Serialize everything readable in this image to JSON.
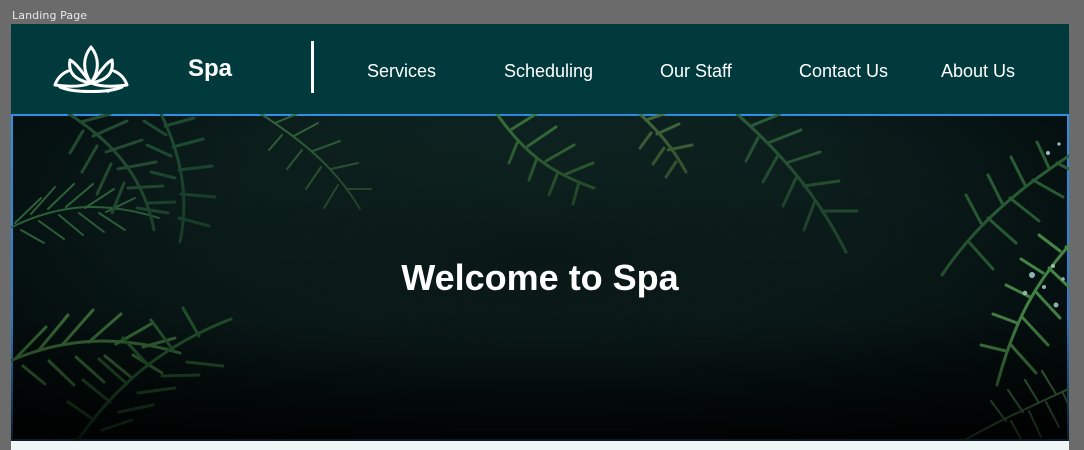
{
  "canvas": {
    "frame_label": "Landing Page"
  },
  "header": {
    "brand": "Spa",
    "logo_icon": "lotus-icon",
    "nav": [
      {
        "label": "Services"
      },
      {
        "label": "Scheduling"
      },
      {
        "label": "Our Staff"
      },
      {
        "label": "Contact Us"
      },
      {
        "label": "About Us"
      }
    ]
  },
  "hero": {
    "title": "Welcome to Spa",
    "background": "tropical fern leaves"
  },
  "colors": {
    "navbar_bg": "#003a3d",
    "hero_text": "#ffffff",
    "selection_outline": "#2f8ee6"
  }
}
